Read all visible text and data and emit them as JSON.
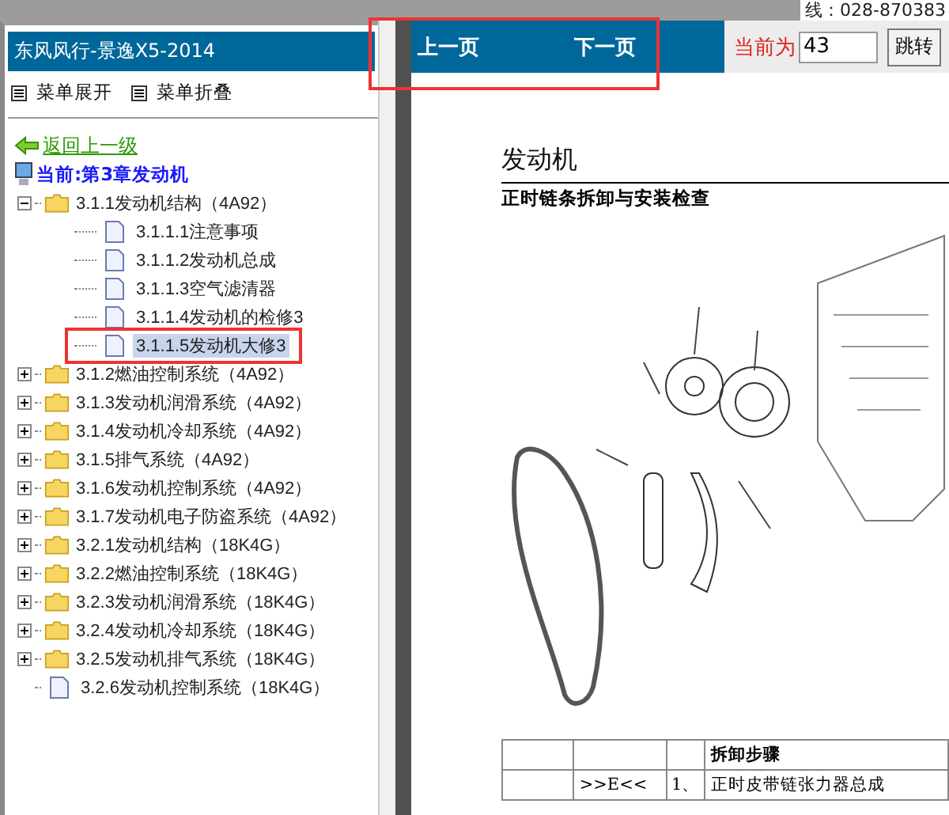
{
  "top_strip": {
    "hotline": "线：028-870383"
  },
  "sidebar": {
    "title": "东风风行-景逸X5-2014",
    "menu_buttons": [
      {
        "label": "菜单展开"
      },
      {
        "label": "菜单折叠"
      }
    ],
    "back_link": "返回上一级",
    "current": "当前:第3章发动机",
    "tree": [
      {
        "kind": "folder",
        "label": "3.1.1发动机结构（4A92）",
        "expanded": true,
        "children": [
          {
            "kind": "page",
            "label": "3.1.1.1注意事项",
            "selected": false
          },
          {
            "kind": "page",
            "label": "3.1.1.2发动机总成",
            "selected": false
          },
          {
            "kind": "page",
            "label": "3.1.1.3空气滤清器",
            "selected": false
          },
          {
            "kind": "page",
            "label": "3.1.1.4发动机的检修3",
            "selected": false
          },
          {
            "kind": "page",
            "label": "3.1.1.5发动机大修3",
            "selected": true
          }
        ]
      },
      {
        "kind": "folder",
        "label": "3.1.2燃油控制系统（4A92）",
        "expanded": false
      },
      {
        "kind": "folder",
        "label": "3.1.3发动机润滑系统（4A92）",
        "expanded": false
      },
      {
        "kind": "folder",
        "label": "3.1.4发动机冷却系统（4A92）",
        "expanded": false
      },
      {
        "kind": "folder",
        "label": "3.1.5排气系统（4A92）",
        "expanded": false
      },
      {
        "kind": "folder",
        "label": "3.1.6发动机控制系统（4A92）",
        "expanded": false
      },
      {
        "kind": "folder",
        "label": "3.1.7发动机电子防盗系统（4A92）",
        "expanded": false
      },
      {
        "kind": "folder",
        "label": "3.2.1发动机结构（18K4G）",
        "expanded": false
      },
      {
        "kind": "folder",
        "label": "3.2.2燃油控制系统（18K4G）",
        "expanded": false
      },
      {
        "kind": "folder",
        "label": "3.2.3发动机润滑系统（18K4G）",
        "expanded": false
      },
      {
        "kind": "folder",
        "label": "3.2.4发动机冷却系统（18K4G）",
        "expanded": false
      },
      {
        "kind": "folder",
        "label": "3.2.5发动机排气系统（18K4G）",
        "expanded": false
      },
      {
        "kind": "page",
        "label": "3.2.6发动机控制系统（18K4G）",
        "selected": false
      }
    ]
  },
  "nav_bar": {
    "prev": "上一页",
    "next": "下一页",
    "current_label": "当前为",
    "page_value": "43",
    "go_button": "跳转"
  },
  "document": {
    "title": "发动机",
    "subtitle": "正时链条拆卸与安装检查",
    "table": {
      "rows": [
        [
          "",
          "",
          "",
          "拆卸步骤"
        ],
        [
          "",
          ">>E<<",
          "1、",
          "正时皮带链张力器总成"
        ]
      ]
    }
  }
}
